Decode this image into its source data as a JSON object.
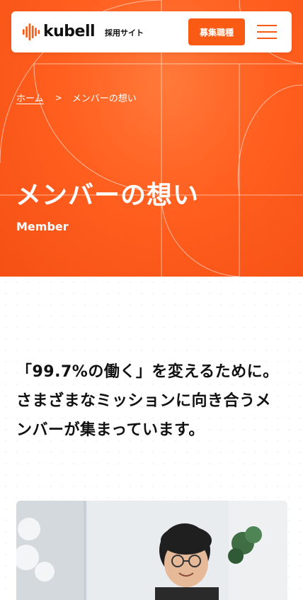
{
  "header": {
    "logo_text": "kubell",
    "site_label": "採用サイト",
    "cta_label": "募集職種"
  },
  "breadcrumb": {
    "home": "ホーム",
    "separator": ">",
    "current": "メンバーの想い"
  },
  "hero": {
    "title": "メンバーの想い",
    "subtitle": "Member"
  },
  "lead": {
    "line1": "「99.7%の働く」を変えるために。",
    "line2": "さまざまなミッションに向き合うメ",
    "line3": "ンバーが集まっています。"
  },
  "colors": {
    "brand": "#f95a14",
    "hero_bg": "#ff5f1f",
    "text": "#111111"
  },
  "icons": {
    "logo": "kubell-waveform-logo-icon",
    "menu": "hamburger-menu-icon"
  }
}
